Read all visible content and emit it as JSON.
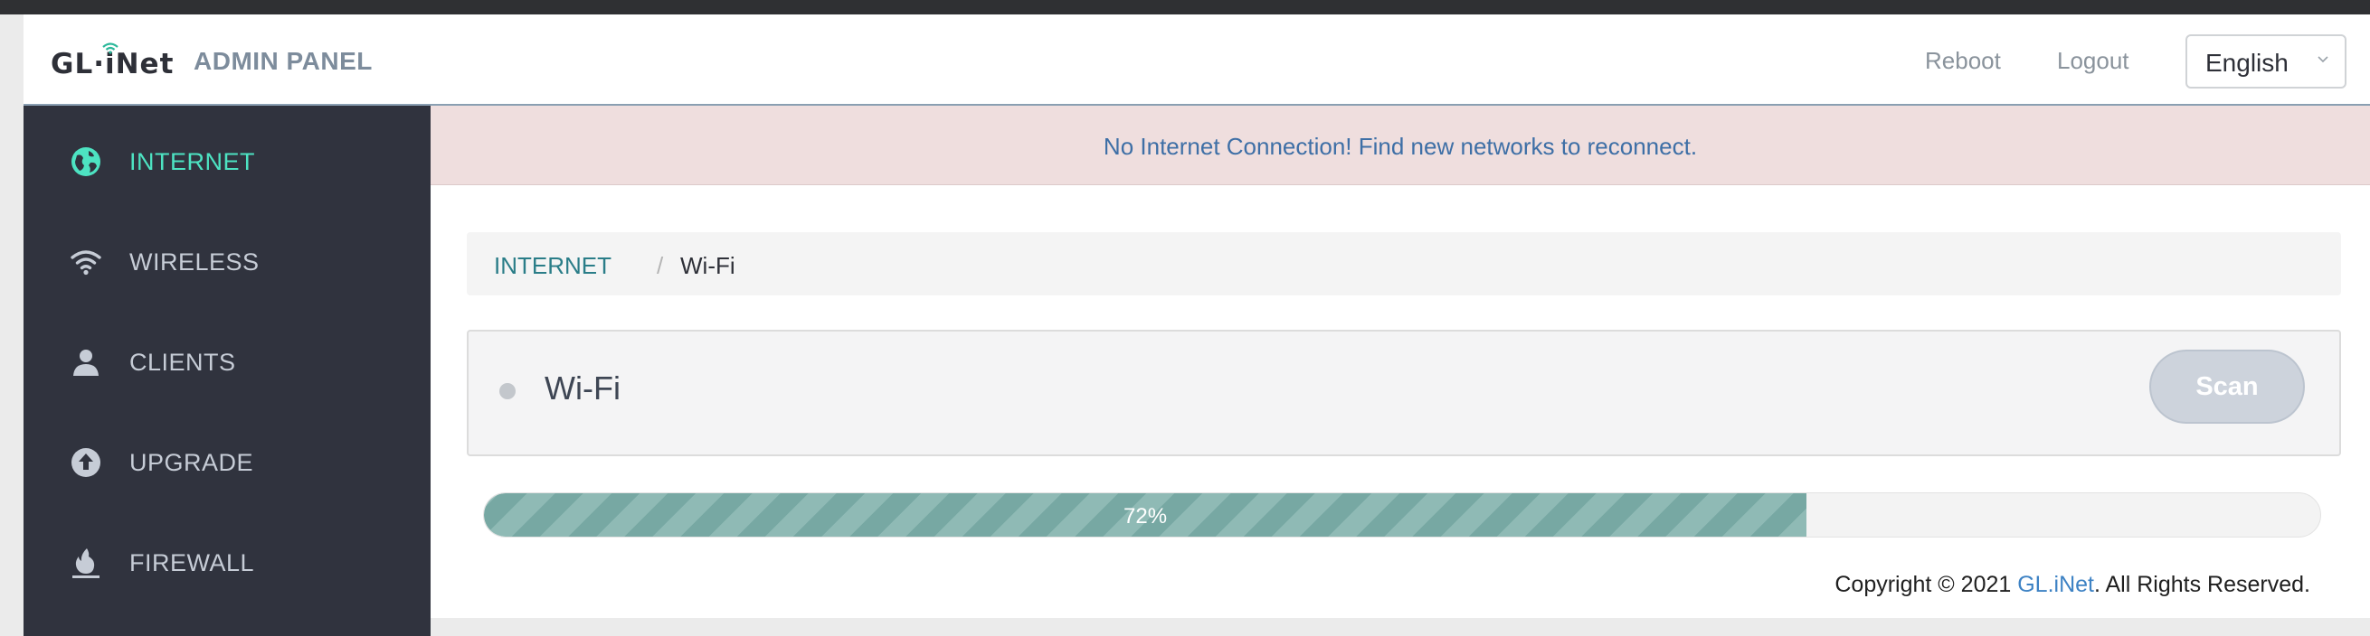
{
  "header": {
    "logo_text": "GL·iNet",
    "title": "ADMIN PANEL",
    "reboot_label": "Reboot",
    "logout_label": "Logout",
    "language_selected": "English"
  },
  "sidebar": {
    "items": [
      {
        "label": "INTERNET",
        "icon": "globe-icon",
        "active": true
      },
      {
        "label": "WIRELESS",
        "icon": "wifi-icon",
        "active": false
      },
      {
        "label": "CLIENTS",
        "icon": "user-icon",
        "active": false
      },
      {
        "label": "UPGRADE",
        "icon": "upgrade-arrow-icon",
        "active": false
      },
      {
        "label": "FIREWALL",
        "icon": "flame-icon",
        "active": false
      }
    ]
  },
  "alert": {
    "message": "No Internet Connection! Find new networks to reconnect."
  },
  "breadcrumb": {
    "parent": "INTERNET",
    "separator": "/",
    "current": "Wi-Fi"
  },
  "panel": {
    "title": "Wi-Fi",
    "scan_label": "Scan"
  },
  "progress": {
    "percent": 72,
    "label": "72%"
  },
  "footer": {
    "prefix": "Copyright © 2021 ",
    "brand": "GL.iNet",
    "suffix": ". All Rights Reserved."
  },
  "colors": {
    "sidebar_bg": "#30333e",
    "active_accent": "#4de3c2",
    "alert_bg": "#efdede",
    "alert_text": "#3e6fa6",
    "progress_fill": "#77a8a3",
    "link": "#2a7d88"
  }
}
